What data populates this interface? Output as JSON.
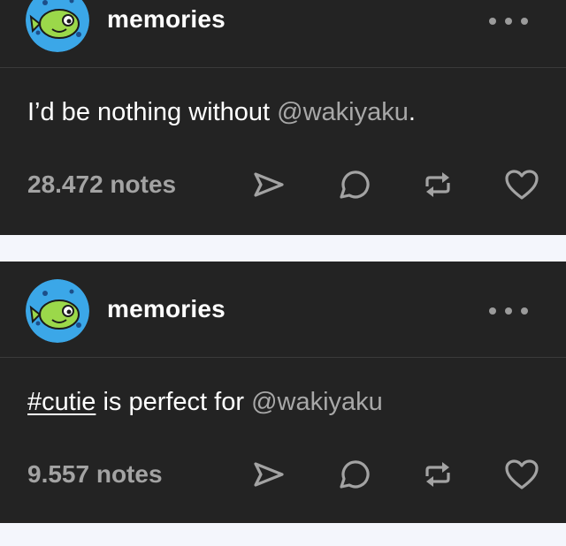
{
  "colors": {
    "post_background": "#232323",
    "page_background": "#f4f6fc",
    "text_primary": "#ffffff",
    "text_muted": "#a3a3a3",
    "icon": "#a3a3a3",
    "avatar_background": "#3ba7e8",
    "avatar_fish": "#9bd84a"
  },
  "posts": [
    {
      "blog_name": "memories",
      "avatar_icon": "pufferfish-avatar-icon",
      "body": {
        "text_before": "I’d be nothing without ",
        "mention": "@wakiyaku",
        "text_after": "."
      },
      "notes": "28.472 notes",
      "actions": [
        "share-icon",
        "reply-icon",
        "reblog-icon",
        "like-icon"
      ]
    },
    {
      "blog_name": "memories",
      "avatar_icon": "pufferfish-avatar-icon",
      "body": {
        "hashtag": "#cutie",
        "text_middle": " is perfect for ",
        "mention": "@wakiyaku"
      },
      "notes": "9.557 notes",
      "actions": [
        "share-icon",
        "reply-icon",
        "reblog-icon",
        "like-icon"
      ]
    }
  ]
}
